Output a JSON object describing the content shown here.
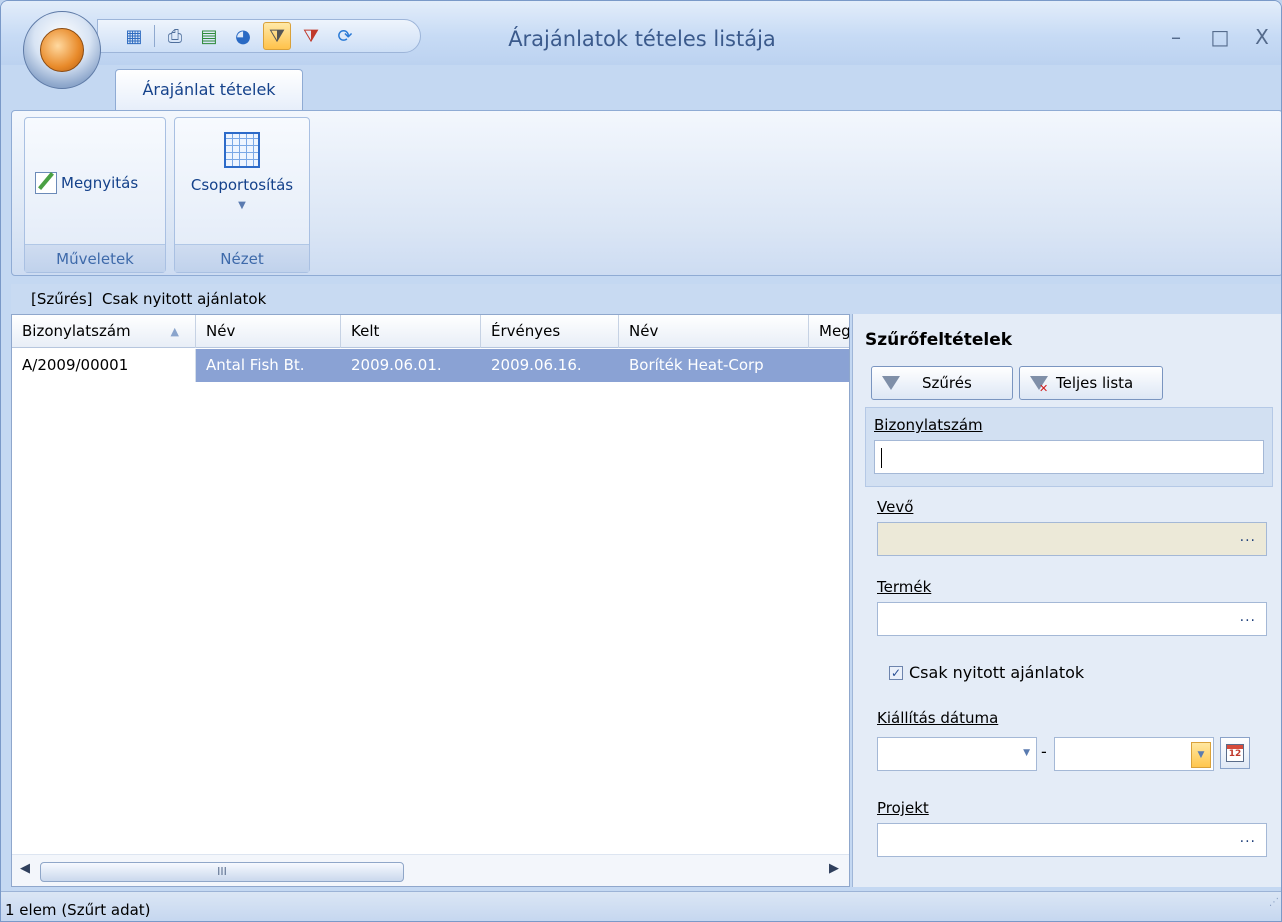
{
  "window": {
    "title": "Árajánlatok tételes listája",
    "controls": {
      "minimize": "–",
      "maximize": "□",
      "close": "X"
    }
  },
  "quick_access": [
    {
      "icon": "grid-check-icon",
      "glyph": "▦"
    },
    {
      "icon": "print-icon",
      "glyph": "⎙"
    },
    {
      "icon": "excel-icon",
      "glyph": "▤"
    },
    {
      "icon": "pie-chart-icon",
      "glyph": "◕"
    },
    {
      "icon": "filter-icon",
      "glyph": "⧩"
    },
    {
      "icon": "clear-filter-icon",
      "glyph": "⧩"
    },
    {
      "icon": "refresh-icon",
      "glyph": "⟳"
    }
  ],
  "ribbon": {
    "tab": "Árajánlat tételek",
    "groups": [
      {
        "label": "Műveletek",
        "button": "Megnyitás"
      },
      {
        "label": "Nézet",
        "button": "Csoportosítás"
      }
    ]
  },
  "filter_caption": "[Szűrés]  Csak nyitott ajánlatok",
  "grid": {
    "columns": [
      "Bizonylatszám",
      "Név",
      "Kelt",
      "Érvényes",
      "Név",
      "Meg"
    ],
    "rows": [
      [
        "A/2009/00001",
        "Antal Fish Bt.",
        "2009.06.01.",
        "2009.06.16.",
        "Boríték Heat-Corp",
        ""
      ]
    ],
    "scroll_thumb": "III",
    "sorted_by": "Bizonylatszám"
  },
  "filters": {
    "title": "Szűrőfeltételek",
    "filter_button": "Szűrés",
    "full_list_button": "Teljes lista",
    "doc_number": {
      "label": "Bizonylatszám",
      "value": ""
    },
    "customer": {
      "label": "Vevő",
      "value": "",
      "browse": "..."
    },
    "product": {
      "label": "Termék",
      "value": "",
      "browse": "..."
    },
    "open_only": {
      "label": "Csak nyitott ajánlatok",
      "checked": true
    },
    "issue_date": {
      "label": "Kiállítás dátuma",
      "separator": "-",
      "from": "",
      "to": ""
    },
    "project": {
      "label": "Projekt",
      "value": "",
      "browse": "..."
    }
  },
  "status": "1 elem (Szűrt adat)",
  "colors": {
    "selection": "#8aa2d4",
    "ribbon_text": "#15428b",
    "title_text": "#3b5a8c"
  }
}
